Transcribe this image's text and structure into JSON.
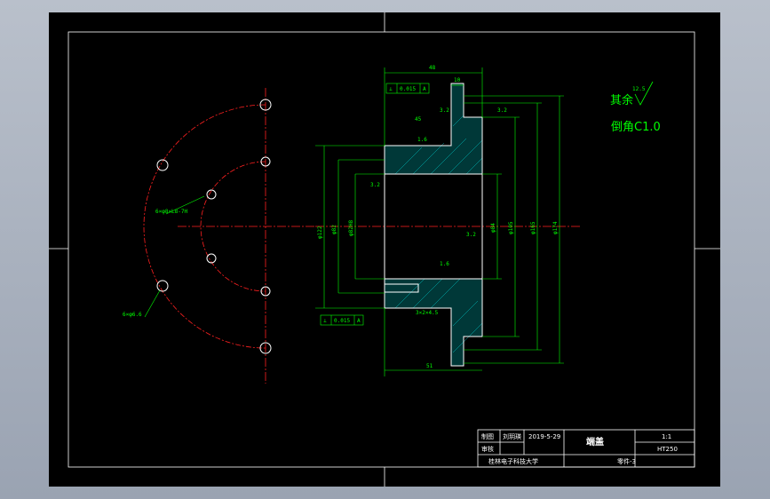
{
  "notes": {
    "rest": "其余",
    "rest_value": "12.5",
    "chamfer": "倒角C1.0"
  },
  "dimensions": {
    "overall_width": "48",
    "flange_width": "10",
    "depth_b": "45",
    "length_bottom": "51",
    "d1": "φ122",
    "d2": "φ82",
    "d3": "φ82H8",
    "d4": "φ84",
    "d5": "φ105",
    "d6": "φ165",
    "d7": "φ174",
    "hole_note_1": "6×φ8×L8-7H",
    "hole_note_2": "6×φ6.6",
    "thread": "3×2×4.5",
    "rough_1": "3.2",
    "rough_2": "1.6",
    "rough_3": "3.2",
    "rough_4": "3.2",
    "rough_5": "1.6",
    "rough_6": "3.2"
  },
  "tolerances": {
    "top": {
      "symbol": "⊥",
      "value": "0.015",
      "datum": "A"
    },
    "bottom": {
      "symbol": "⊥",
      "value": "0.015",
      "datum": "A"
    }
  },
  "title_block": {
    "row1_label": "制图",
    "row1_name": "刘玥瑛",
    "row1_date": "2019-5-29",
    "row2_label": "审核",
    "part_name": "端盖",
    "scale": "1:1",
    "material": "HT250",
    "school": "桂林电子科技大学",
    "drawing_no": "零件-3"
  },
  "colors": {
    "center": "#ff2020",
    "dim": "#00ff00",
    "outline": "#ffffff",
    "hatch": "#00e0e0"
  }
}
